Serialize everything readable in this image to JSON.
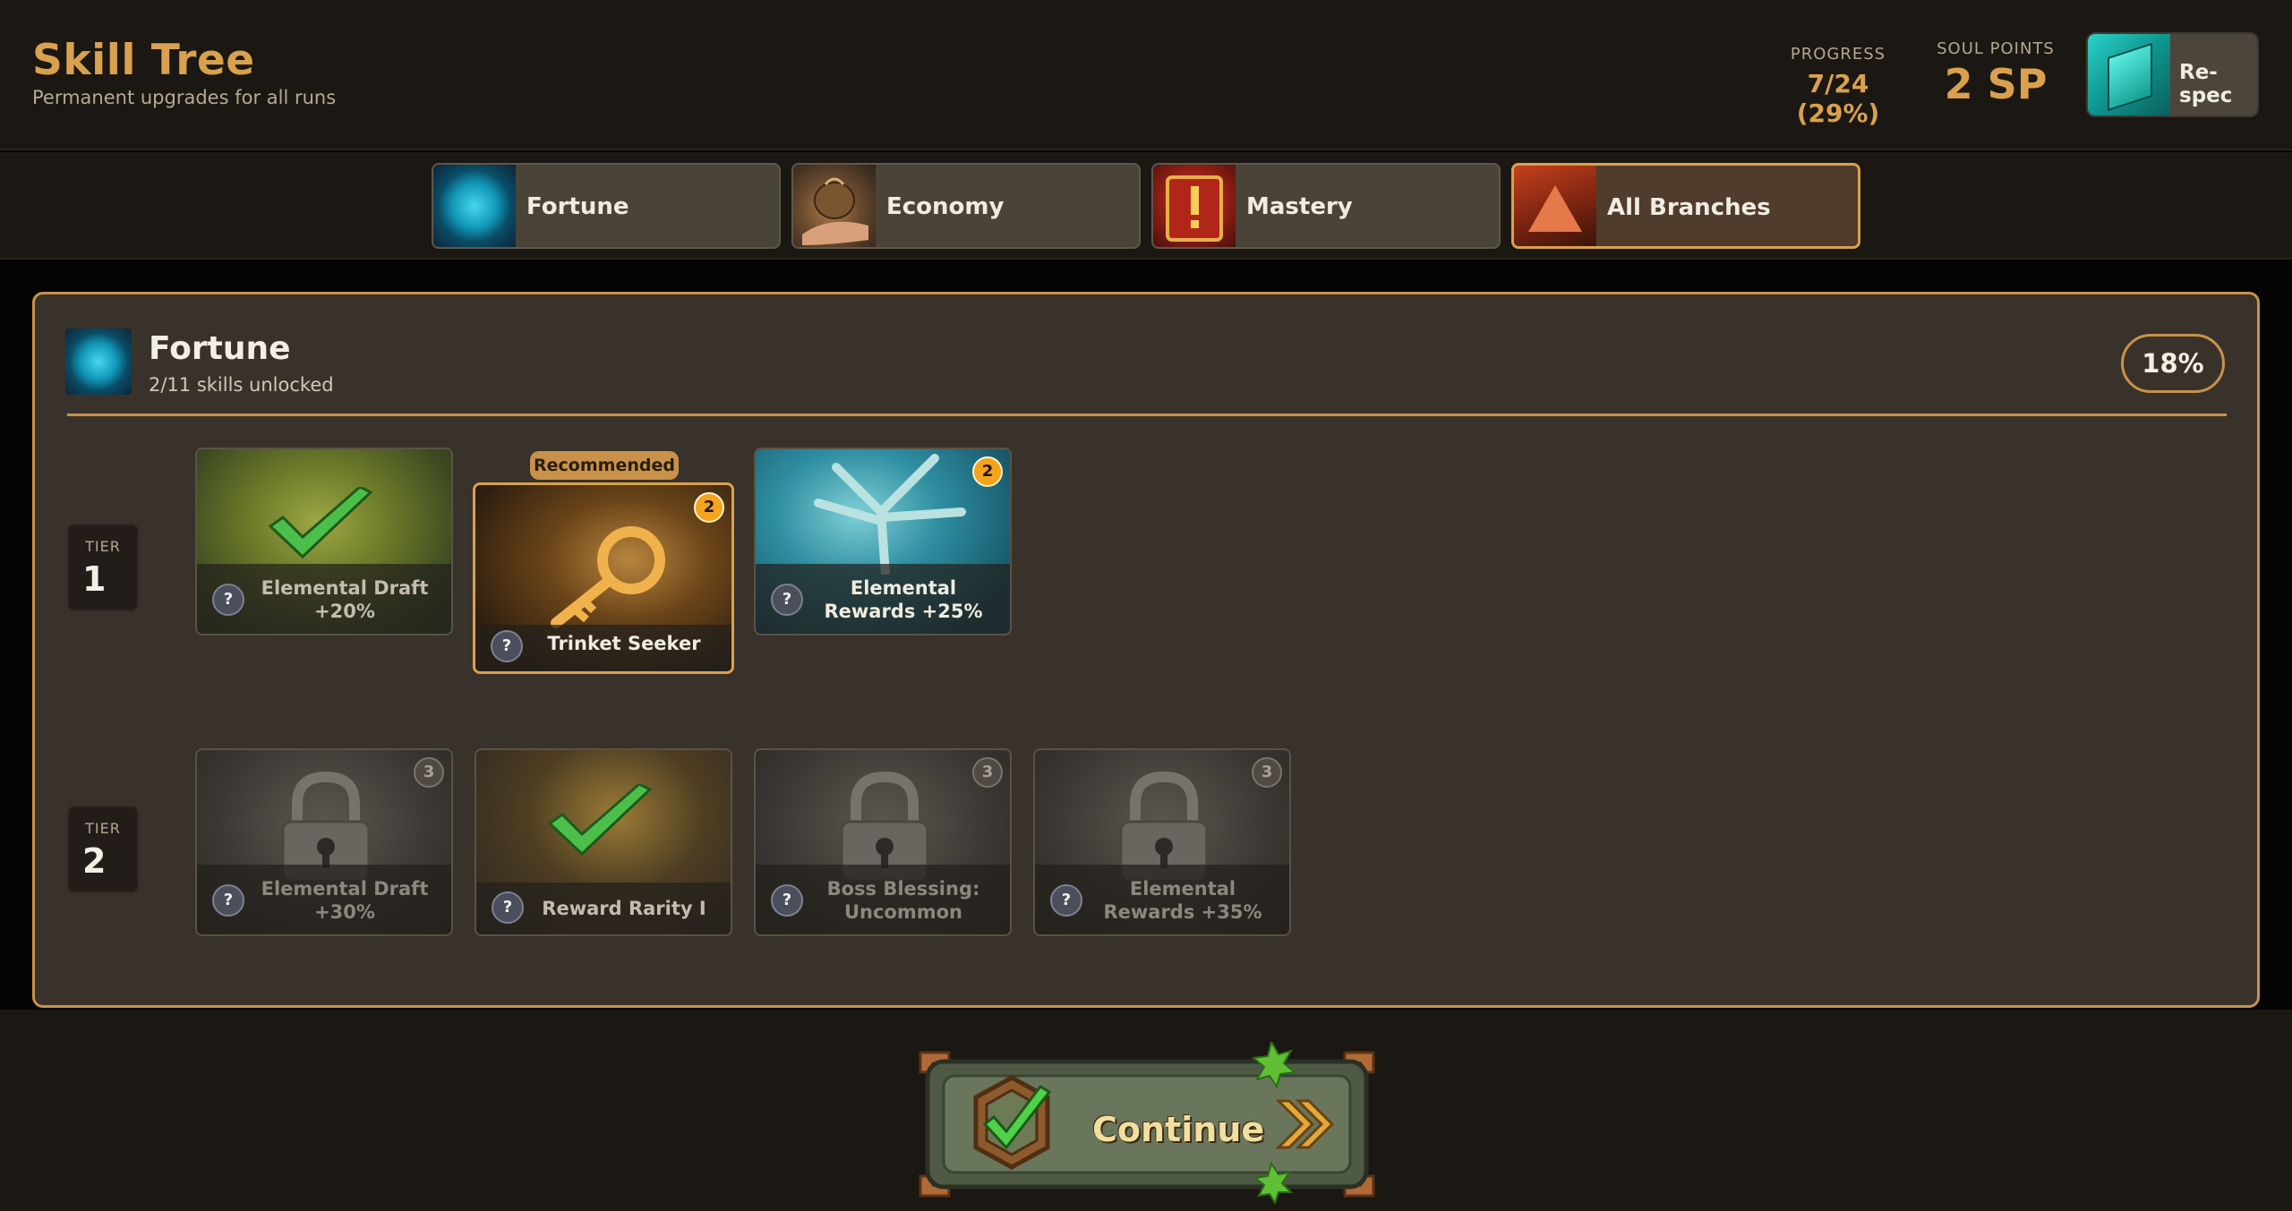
{
  "header": {
    "title": "Skill Tree",
    "subtitle": "Permanent upgrades for all runs",
    "progress_label": "PROGRESS",
    "progress_value": "7/24 (29%)",
    "soul_label": "SOUL POINTS",
    "soul_value": "2 SP",
    "respec_label": "Re-spec",
    "respec_icon": "teal-block-icon"
  },
  "tabs": [
    {
      "label": "Fortune",
      "icon": "fortune-orb-icon",
      "active": false
    },
    {
      "label": "Economy",
      "icon": "coin-bag-icon",
      "active": false
    },
    {
      "label": "Mastery",
      "icon": "red-book-icon",
      "active": false
    },
    {
      "label": "All Branches",
      "icon": "pyramid-icon",
      "active": true
    }
  ],
  "panel": {
    "title": "Fortune",
    "subtitle": "2/11 skills unlocked",
    "percent": "18%",
    "recommended_label": "Recommended",
    "tiers": [
      {
        "label": "TIER",
        "number": "1",
        "skills": [
          {
            "name": "Elemental Draft +20%",
            "state": "unlocked",
            "art": "green-checkmark-icon"
          },
          {
            "name": "Trinket Seeker",
            "state": "available",
            "cost": "2",
            "recommended": true,
            "art": "golden-key-icon"
          },
          {
            "name": "Elemental Rewards +25%",
            "state": "available",
            "cost": "2",
            "art": "teal-tree-icon"
          }
        ]
      },
      {
        "label": "TIER",
        "number": "2",
        "skills": [
          {
            "name": "Elemental Draft +30%",
            "state": "locked",
            "cost": "3",
            "art": "padlock-icon"
          },
          {
            "name": "Reward Rarity I",
            "state": "unlocked",
            "art": "green-checkmark-icon"
          },
          {
            "name": "Boss Blessing: Uncommon",
            "state": "locked",
            "cost": "3",
            "art": "padlock-icon"
          },
          {
            "name": "Elemental Rewards +35%",
            "state": "locked",
            "cost": "3",
            "art": "padlock-icon"
          }
        ]
      }
    ],
    "help_glyph": "?"
  },
  "continue_label": "Continue",
  "colors": {
    "accent": "#d9a04e",
    "background": "#1b1712",
    "panel": "#39322a",
    "cost_badge": "#f3a31c"
  }
}
